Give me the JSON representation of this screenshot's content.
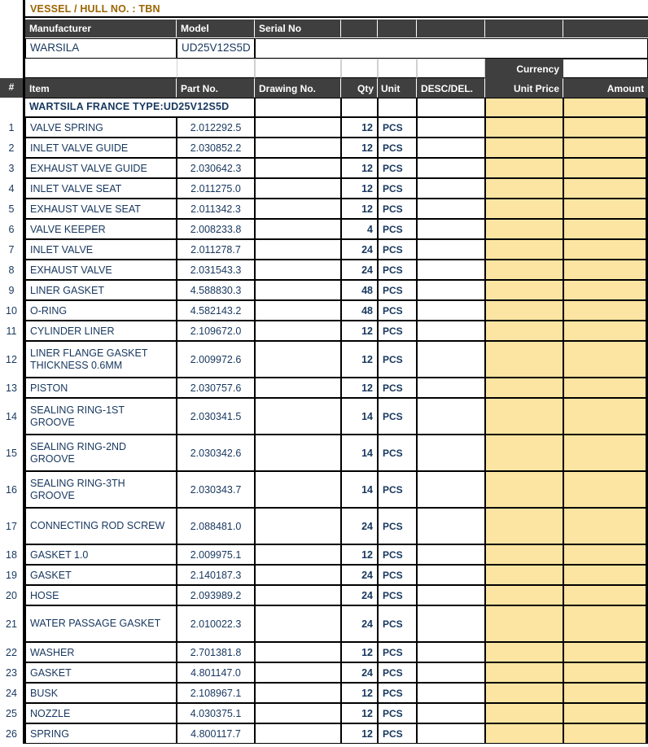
{
  "document": {
    "title_row": {
      "label": "VESSEL / HULL NO. : TBN",
      "color": "#9C6500"
    },
    "equipment_header": {
      "columns": [
        "Manufacturer",
        "Model",
        "Serial No",
        "",
        "",
        "",
        "",
        ""
      ]
    },
    "equipment_values": {
      "manufacturer": "WARSILA",
      "model": "UD25V12S5D",
      "serial_no": ""
    },
    "currency_label": "Currency",
    "currency_value": "",
    "table_header": {
      "index": "#",
      "item": "Item",
      "part_no": "Part No.",
      "drawing_no": "Drawing No.",
      "qty": "Qty",
      "unit": "Unit",
      "desc_del": "DESC/DEL.",
      "unit_price": "Unit Price",
      "amount": "Amount"
    },
    "section_title": "WARTSILA  FRANCE  TYPE:UD25V12S5D",
    "theme": {
      "header_bg": "#3F3F3F",
      "header_fg": "#FFFFFF",
      "price_fill": "#FCE4A2",
      "text": "#17375E",
      "grid": "#000000"
    },
    "rows": [
      {
        "no": "1",
        "item": "VALVE SPRING",
        "part_no": "2.012292.5",
        "drawing_no": "",
        "qty": "12",
        "unit": "PCS",
        "desc_del": "",
        "unit_price": "",
        "amount": ""
      },
      {
        "no": "2",
        "item": "INLET VALVE GUIDE",
        "part_no": "2.030852.2",
        "drawing_no": "",
        "qty": "12",
        "unit": "PCS",
        "desc_del": "",
        "unit_price": "",
        "amount": ""
      },
      {
        "no": "3",
        "item": "EXHAUST VALVE GUIDE",
        "part_no": "2.030642.3",
        "drawing_no": "",
        "qty": "12",
        "unit": "PCS",
        "desc_del": "",
        "unit_price": "",
        "amount": ""
      },
      {
        "no": "4",
        "item": "INLET VALVE SEAT",
        "part_no": "2.011275.0",
        "drawing_no": "",
        "qty": "12",
        "unit": "PCS",
        "desc_del": "",
        "unit_price": "",
        "amount": ""
      },
      {
        "no": "5",
        "item": "EXHAUST VALVE SEAT",
        "part_no": "2.011342.3",
        "drawing_no": "",
        "qty": "12",
        "unit": "PCS",
        "desc_del": "",
        "unit_price": "",
        "amount": ""
      },
      {
        "no": "6",
        "item": "VALVE KEEPER",
        "part_no": "2.008233.8",
        "drawing_no": "",
        "qty": "4",
        "unit": "PCS",
        "desc_del": "",
        "unit_price": "",
        "amount": ""
      },
      {
        "no": "7",
        "item": "INLET VALVE",
        "part_no": "2.011278.7",
        "drawing_no": "",
        "qty": "24",
        "unit": "PCS",
        "desc_del": "",
        "unit_price": "",
        "amount": ""
      },
      {
        "no": "8",
        "item": "EXHAUST VALVE",
        "part_no": "2.031543.3",
        "drawing_no": "",
        "qty": "24",
        "unit": "PCS",
        "desc_del": "",
        "unit_price": "",
        "amount": ""
      },
      {
        "no": "9",
        "item": "LINER GASKET",
        "part_no": "4.588830.3",
        "drawing_no": "",
        "qty": "48",
        "unit": "PCS",
        "desc_del": "",
        "unit_price": "",
        "amount": ""
      },
      {
        "no": "10",
        "item": "O-RING",
        "part_no": "4.582143.2",
        "drawing_no": "",
        "qty": "48",
        "unit": "PCS",
        "desc_del": "",
        "unit_price": "",
        "amount": ""
      },
      {
        "no": "11",
        "item": "CYLINDER LINER",
        "part_no": "2.109672.0",
        "drawing_no": "",
        "qty": "12",
        "unit": "PCS",
        "desc_del": "",
        "unit_price": "",
        "amount": ""
      },
      {
        "no": "12",
        "item": "LINER FLANGE GASKET THICKNESS 0.6MM",
        "part_no": "2.009972.6",
        "drawing_no": "",
        "qty": "12",
        "unit": "PCS",
        "desc_del": "",
        "unit_price": "",
        "amount": "",
        "tall": true
      },
      {
        "no": "13",
        "item": "PISTON",
        "part_no": "2.030757.6",
        "drawing_no": "",
        "qty": "12",
        "unit": "PCS",
        "desc_del": "",
        "unit_price": "",
        "amount": ""
      },
      {
        "no": "14",
        "item": "SEALING RING-1ST GROOVE",
        "part_no": "2.030341.5",
        "drawing_no": "",
        "qty": "14",
        "unit": "PCS",
        "desc_del": "",
        "unit_price": "",
        "amount": "",
        "tall": true
      },
      {
        "no": "15",
        "item": "SEALING RING-2ND GROOVE",
        "part_no": "2.030342.6",
        "drawing_no": "",
        "qty": "14",
        "unit": "PCS",
        "desc_del": "",
        "unit_price": "",
        "amount": "",
        "tall": true
      },
      {
        "no": "16",
        "item": "SEALING RING-3TH GROOVE",
        "part_no": "2.030343.7",
        "drawing_no": "",
        "qty": "14",
        "unit": "PCS",
        "desc_del": "",
        "unit_price": "",
        "amount": "",
        "tall": true
      },
      {
        "no": "17",
        "item": "CONNECTING ROD SCREW",
        "part_no": "2.088481.0",
        "drawing_no": "",
        "qty": "24",
        "unit": "PCS",
        "desc_del": "",
        "unit_price": "",
        "amount": "",
        "tall": true
      },
      {
        "no": "18",
        "item": "GASKET 1.0",
        "part_no": "2.009975.1",
        "drawing_no": "",
        "qty": "12",
        "unit": "PCS",
        "desc_del": "",
        "unit_price": "",
        "amount": ""
      },
      {
        "no": "19",
        "item": "GASKET",
        "part_no": "2.140187.3",
        "drawing_no": "",
        "qty": "24",
        "unit": "PCS",
        "desc_del": "",
        "unit_price": "",
        "amount": ""
      },
      {
        "no": "20",
        "item": "HOSE",
        "part_no": "2.093989.2",
        "drawing_no": "",
        "qty": "24",
        "unit": "PCS",
        "desc_del": "",
        "unit_price": "",
        "amount": ""
      },
      {
        "no": "21",
        "item": "WATER PASSAGE GASKET",
        "part_no": "2.010022.3",
        "drawing_no": "",
        "qty": "24",
        "unit": "PCS",
        "desc_del": "",
        "unit_price": "",
        "amount": "",
        "tall": true
      },
      {
        "no": "22",
        "item": "WASHER",
        "part_no": "2.701381.8",
        "drawing_no": "",
        "qty": "12",
        "unit": "PCS",
        "desc_del": "",
        "unit_price": "",
        "amount": ""
      },
      {
        "no": "23",
        "item": "GASKET",
        "part_no": "4.801147.0",
        "drawing_no": "",
        "qty": "24",
        "unit": "PCS",
        "desc_del": "",
        "unit_price": "",
        "amount": ""
      },
      {
        "no": "24",
        "item": "BUSK",
        "part_no": "2.108967.1",
        "drawing_no": "",
        "qty": "12",
        "unit": "PCS",
        "desc_del": "",
        "unit_price": "",
        "amount": ""
      },
      {
        "no": "25",
        "item": "NOZZLE",
        "part_no": "4.030375.1",
        "drawing_no": "",
        "qty": "12",
        "unit": "PCS",
        "desc_del": "",
        "unit_price": "",
        "amount": ""
      },
      {
        "no": "26",
        "item": "SPRING",
        "part_no": "4.800117.7",
        "drawing_no": "",
        "qty": "12",
        "unit": "PCS",
        "desc_del": "",
        "unit_price": "",
        "amount": ""
      }
    ]
  }
}
